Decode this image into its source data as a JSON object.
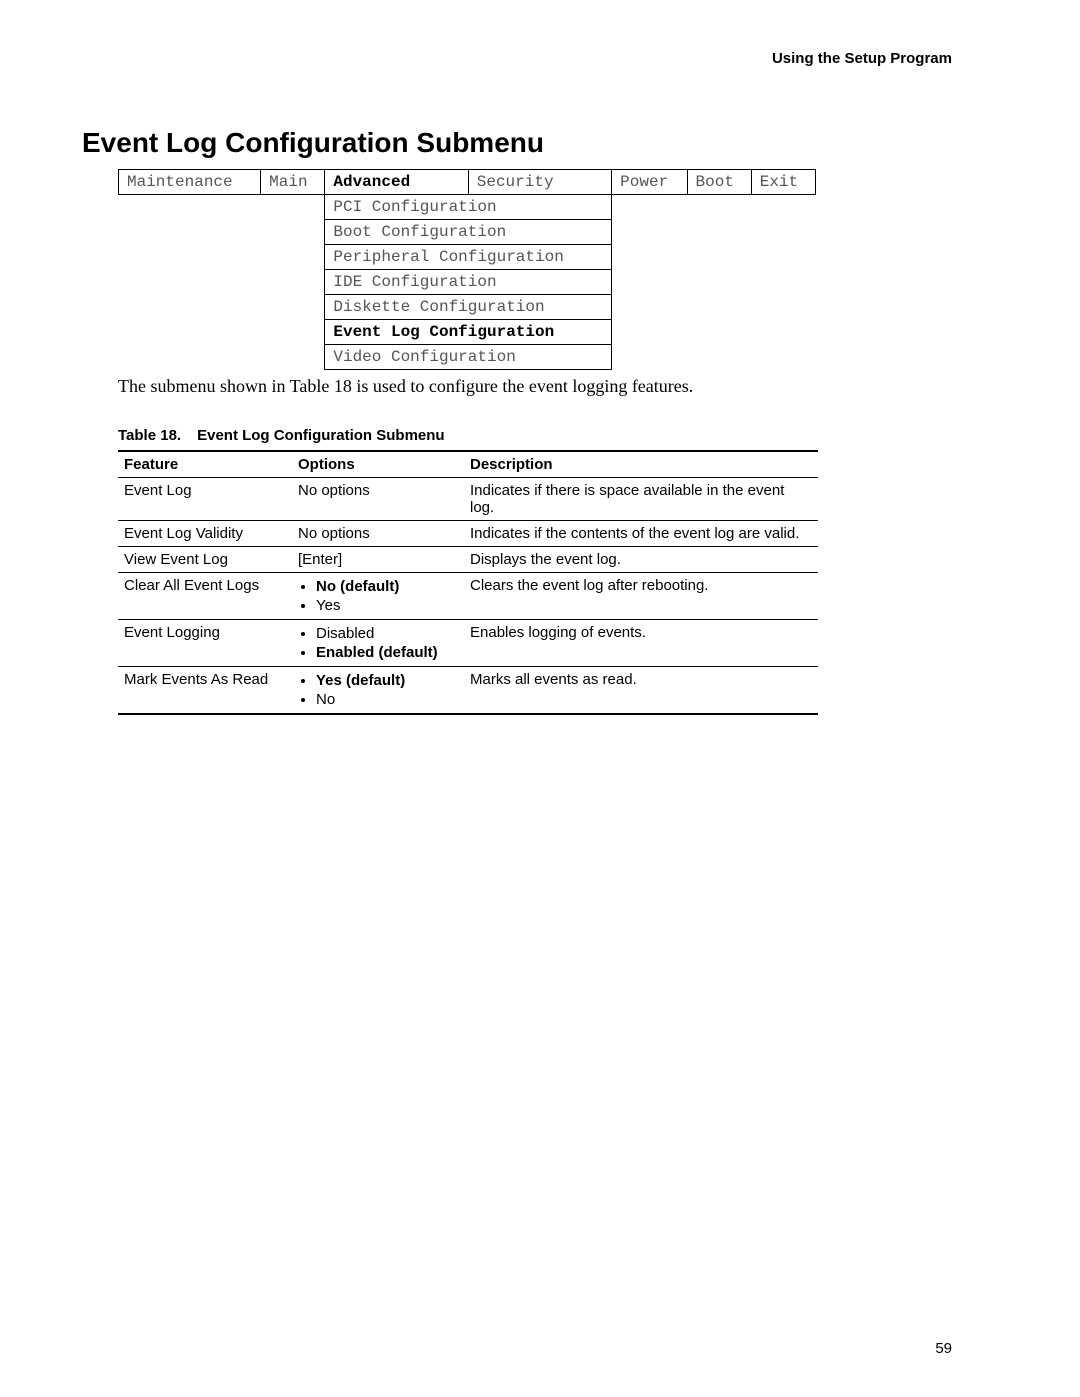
{
  "running_header": "Using the Setup Program",
  "section_title": "Event Log Configuration Submenu",
  "menu_bar": {
    "items": [
      "Maintenance",
      "Main",
      "Advanced",
      "Security",
      "Power",
      "Boot",
      "Exit"
    ],
    "active_index": 2
  },
  "submenu_items": [
    {
      "label": "PCI Configuration",
      "selected": false
    },
    {
      "label": "Boot Configuration",
      "selected": false
    },
    {
      "label": "Peripheral Configuration",
      "selected": false
    },
    {
      "label": "IDE Configuration",
      "selected": false
    },
    {
      "label": "Diskette Configuration",
      "selected": false
    },
    {
      "label": "Event Log Configuration",
      "selected": true
    },
    {
      "label": "Video Configuration",
      "selected": false
    }
  ],
  "body_text": "The submenu shown in Table 18 is used to configure the event logging features.",
  "table_caption_prefix": "Table 18.",
  "table_caption_title": "Event Log Configuration Submenu",
  "table_headers": {
    "feature": "Feature",
    "options": "Options",
    "description": "Description"
  },
  "table_rows": [
    {
      "feature": "Event Log",
      "options_text": "No options",
      "description": "Indicates if there is space available in the event log."
    },
    {
      "feature": "Event Log Validity",
      "options_text": "No options",
      "description": "Indicates if the contents of the event log are valid."
    },
    {
      "feature": "View Event Log",
      "options_text": "[Enter]",
      "description": "Displays the event log."
    },
    {
      "feature": "Clear All Event Logs",
      "options_list": [
        {
          "text": "No (default)",
          "bold": true
        },
        {
          "text": "Yes",
          "bold": false
        }
      ],
      "description": "Clears the event log after rebooting."
    },
    {
      "feature": "Event Logging",
      "options_list": [
        {
          "text": "Disabled",
          "bold": false
        },
        {
          "text": "Enabled (default)",
          "bold": true
        }
      ],
      "description": "Enables logging of events."
    },
    {
      "feature": "Mark Events As Read",
      "options_list": [
        {
          "text": "Yes (default)",
          "bold": true
        },
        {
          "text": "No",
          "bold": false
        }
      ],
      "description": "Marks all events as read."
    }
  ],
  "page_number": "59"
}
